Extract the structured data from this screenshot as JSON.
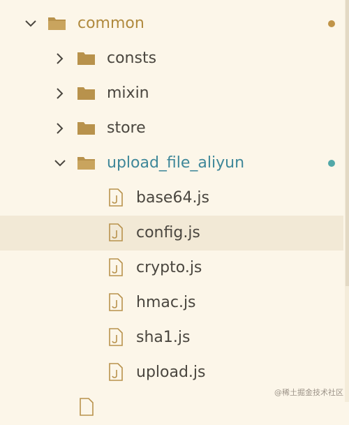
{
  "explorer": {
    "colors": {
      "background": "#fcf6e9",
      "folder_icon": "#b8924c",
      "modified_dot": "#c09448",
      "untracked_dot": "#52a8a8"
    },
    "rows": [
      {
        "label": "common",
        "type": "folder",
        "expanded": true,
        "icon": "folder-open-icon",
        "status_dot": "modified"
      },
      {
        "label": "consts",
        "type": "folder",
        "expanded": false,
        "icon": "folder-icon"
      },
      {
        "label": "mixin",
        "type": "folder",
        "expanded": false,
        "icon": "folder-icon"
      },
      {
        "label": "store",
        "type": "folder",
        "expanded": false,
        "icon": "folder-icon"
      },
      {
        "label": "upload_file_aliyun",
        "type": "folder",
        "expanded": true,
        "icon": "folder-open-icon",
        "status_dot": "untracked"
      },
      {
        "label": "base64.js",
        "type": "file",
        "icon": "js-file-icon"
      },
      {
        "label": "config.js",
        "type": "file",
        "icon": "js-file-icon",
        "selected": true
      },
      {
        "label": "crypto.js",
        "type": "file",
        "icon": "js-file-icon"
      },
      {
        "label": "hmac.js",
        "type": "file",
        "icon": "js-file-icon"
      },
      {
        "label": "sha1.js",
        "type": "file",
        "icon": "js-file-icon"
      },
      {
        "label": "upload.js",
        "type": "file",
        "icon": "js-file-icon"
      }
    ]
  },
  "watermark": "@稀土掘金技术社区"
}
